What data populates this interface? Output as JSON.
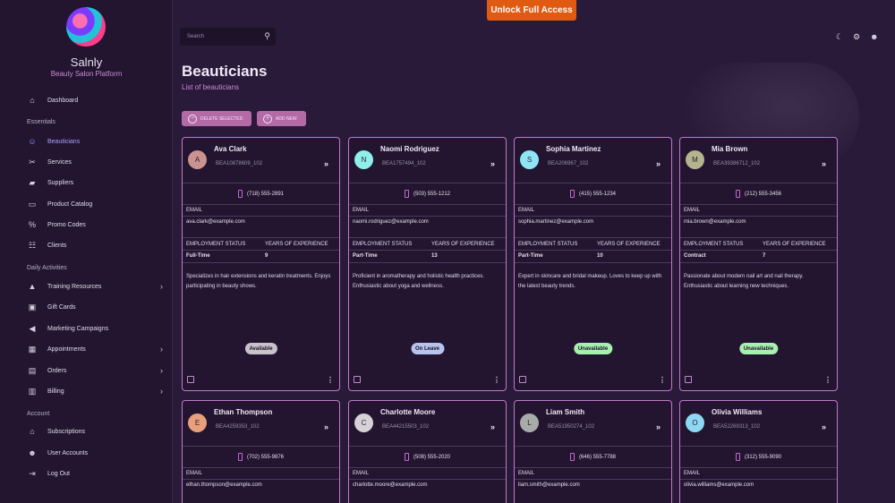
{
  "app": {
    "name": "Salnly",
    "subtitle": "Beauty Salon Platform"
  },
  "topbar": {
    "unlock_label": "Unlock Full Access",
    "search_placeholder": "Search"
  },
  "sidebar": {
    "dashboard": "Dashboard",
    "section_essentials": "Essentials",
    "essentials": [
      "Beauticians",
      "Services",
      "Suppliers",
      "Product Catalog",
      "Promo Codes",
      "Clients"
    ],
    "section_daily": "Daily Activities",
    "daily": [
      "Training Resources",
      "Gift Cards",
      "Marketing Campaigns",
      "Appointments",
      "Orders",
      "Billing"
    ],
    "section_account": "Account",
    "account": [
      "Subscriptions",
      "User Accounts",
      "Log Out"
    ]
  },
  "page": {
    "title": "Beauticians",
    "subtitle": "List of beauticians",
    "delete_label": "DELETE SELECTED",
    "add_label": "ADD NEW"
  },
  "labels": {
    "email": "EMAIL",
    "employment_status": "EMPLOYMENT STATUS",
    "years_experience": "YEARS OF EXPERIENCE"
  },
  "cards": [
    {
      "initial": "A",
      "name": "Ava Clark",
      "code": "BEA10878609_102",
      "phone": "(718) 555-2891",
      "email": "ava.clark@example.com",
      "status": "Full-Time",
      "years": "9",
      "desc": "Specializes in hair extensions and keratin treatments. Enjoys participating in beauty shows.",
      "availability": "Available",
      "avatar_color": "#c9938f",
      "badge_color": "#c8c2cc"
    },
    {
      "initial": "N",
      "name": "Naomi Rodriguez",
      "code": "BEA1757494_102",
      "phone": "(503) 555-1212",
      "email": "naomi.rodriguez@example.com",
      "status": "Part-Time",
      "years": "13",
      "desc": "Proficient in aromatherapy and holistic health practices. Enthusiastic about yoga and wellness.",
      "availability": "On Leave",
      "avatar_color": "#8ef0e8",
      "badge_color": "#b8c4ee"
    },
    {
      "initial": "S",
      "name": "Sophia Martinez",
      "code": "BEA206967_102",
      "phone": "(415) 555-1234",
      "email": "sophia.martinez@example.com",
      "status": "Part-Time",
      "years": "10",
      "desc": "Expert in skincare and bridal makeup. Loves to keep up with the latest beauty trends.",
      "availability": "Unavailable",
      "avatar_color": "#8ee6f4",
      "badge_color": "#a6f0b0"
    },
    {
      "initial": "M",
      "name": "Mia Brown",
      "code": "BEA39386712_102",
      "phone": "(212) 555-3456",
      "email": "mia.brown@example.com",
      "status": "Contract",
      "years": "7",
      "desc": "Passionate about modern nail art and nail therapy. Enthusiastic about learning new techniques.",
      "availability": "Unavailable",
      "avatar_color": "#b5b48e",
      "badge_color": "#a6f0b0"
    },
    {
      "initial": "E",
      "name": "Ethan Thompson",
      "code": "BEA4259353_102",
      "phone": "(702) 555-9876",
      "email": "ethan.thompson@example.com",
      "avatar_color": "#e8a07a"
    },
    {
      "initial": "C",
      "name": "Charlotte Moore",
      "code": "BEA44215503_102",
      "phone": "(508) 555-2020",
      "email": "charlotte.moore@example.com",
      "avatar_color": "#d6d2d6"
    },
    {
      "initial": "L",
      "name": "Liam Smith",
      "code": "BEA51950274_102",
      "phone": "(646) 555-7788",
      "email": "liam.smith@example.com",
      "avatar_color": "#a8aca8"
    },
    {
      "initial": "O",
      "name": "Olivia Williams",
      "code": "BEA52269313_102",
      "phone": "(312) 555-9090",
      "email": "olivia.williams@example.com",
      "avatar_color": "#8ed8f4"
    }
  ]
}
